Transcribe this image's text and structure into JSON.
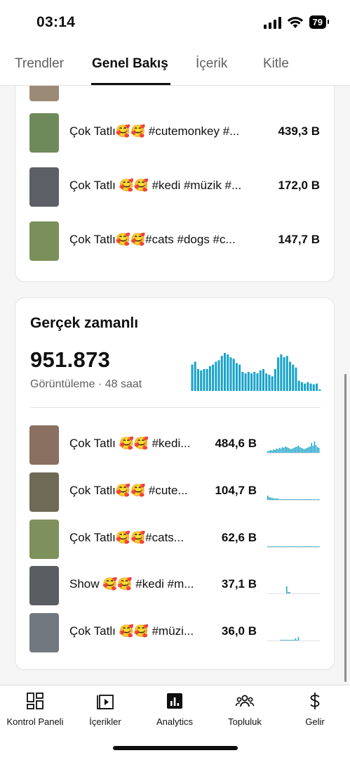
{
  "status_bar": {
    "time": "03:14",
    "battery": "79"
  },
  "tabs": [
    {
      "label": "Trendler"
    },
    {
      "label": "Genel Bakış",
      "active": true
    },
    {
      "label": "İçerik"
    },
    {
      "label": "Kitle"
    }
  ],
  "top_list": [
    {
      "title": "Çok Tatlı🥰🥰 #cutemonkey #...",
      "value": "439,3 B",
      "thumb": "#6f8a5a"
    },
    {
      "title": "Çok Tatlı 🥰🥰 #kedi #müzik #...",
      "value": "172,0 B",
      "thumb": "#5c6066"
    },
    {
      "title": "Çok Tatlı🥰🥰#cats #dogs  #c...",
      "value": "147,7 B",
      "thumb": "#7a8f5a"
    }
  ],
  "realtime": {
    "title": "Gerçek zamanlı",
    "views": "951.873",
    "subtitle": "Görüntüleme · 48 saat",
    "accent_color": "#1aa3c9",
    "chart_values": [
      36,
      40,
      30,
      28,
      30,
      30,
      34,
      36,
      40,
      42,
      48,
      52,
      50,
      46,
      44,
      38,
      36,
      26,
      24,
      26,
      24,
      26,
      24,
      28,
      30,
      24,
      22,
      20,
      30,
      46,
      50,
      46,
      48,
      40,
      36,
      32,
      14,
      12,
      10,
      12,
      10,
      9,
      10,
      2
    ],
    "items": [
      {
        "title": "Çok Tatlı 🥰🥰 #kedi...",
        "value": "484,6 B",
        "thumb": "#8a7060",
        "spark": [
          0,
          0,
          0,
          0,
          0,
          0,
          0,
          0,
          0,
          0,
          0,
          0,
          0,
          0,
          0,
          0,
          0,
          0,
          0,
          0,
          0,
          0,
          0,
          0,
          0,
          0,
          0,
          0,
          0,
          0,
          0,
          0,
          0,
          0,
          0,
          0,
          0,
          0,
          0,
          0,
          0,
          0,
          0,
          0,
          0,
          0,
          0,
          0,
          0,
          0,
          0,
          0,
          0,
          0,
          0,
          0,
          0,
          0,
          0,
          0,
          0,
          0,
          0,
          0,
          0,
          0,
          0,
          0,
          0,
          0
        ]
      },
      {
        "title": "Çok Tatlı🥰🥰 #cute...",
        "value": "104,7 B",
        "thumb": "#6e6a55",
        "spark": [
          0
        ]
      },
      {
        "title": "Çok Tatlı🥰🥰#cats...",
        "value": "62,6 B",
        "thumb": "#7e905c",
        "spark": [
          0
        ]
      },
      {
        "title": "Show 🥰🥰 #kedi #m...",
        "value": "37,1 B",
        "thumb": "#5a5e62",
        "spark": [
          0
        ]
      },
      {
        "title": "Çok Tatlı 🥰🥰 #müzi...",
        "value": "36,0 B",
        "thumb": "#727880",
        "spark": [
          0
        ]
      }
    ]
  },
  "bottom_nav": [
    {
      "label": "Kontrol Paneli",
      "icon": "dashboard-icon"
    },
    {
      "label": "İçerikler",
      "icon": "content-play-icon"
    },
    {
      "label": "Analytics",
      "icon": "analytics-icon"
    },
    {
      "label": "Topluluk",
      "icon": "community-icon"
    },
    {
      "label": "Gelir",
      "icon": "dollar-icon"
    }
  ]
}
